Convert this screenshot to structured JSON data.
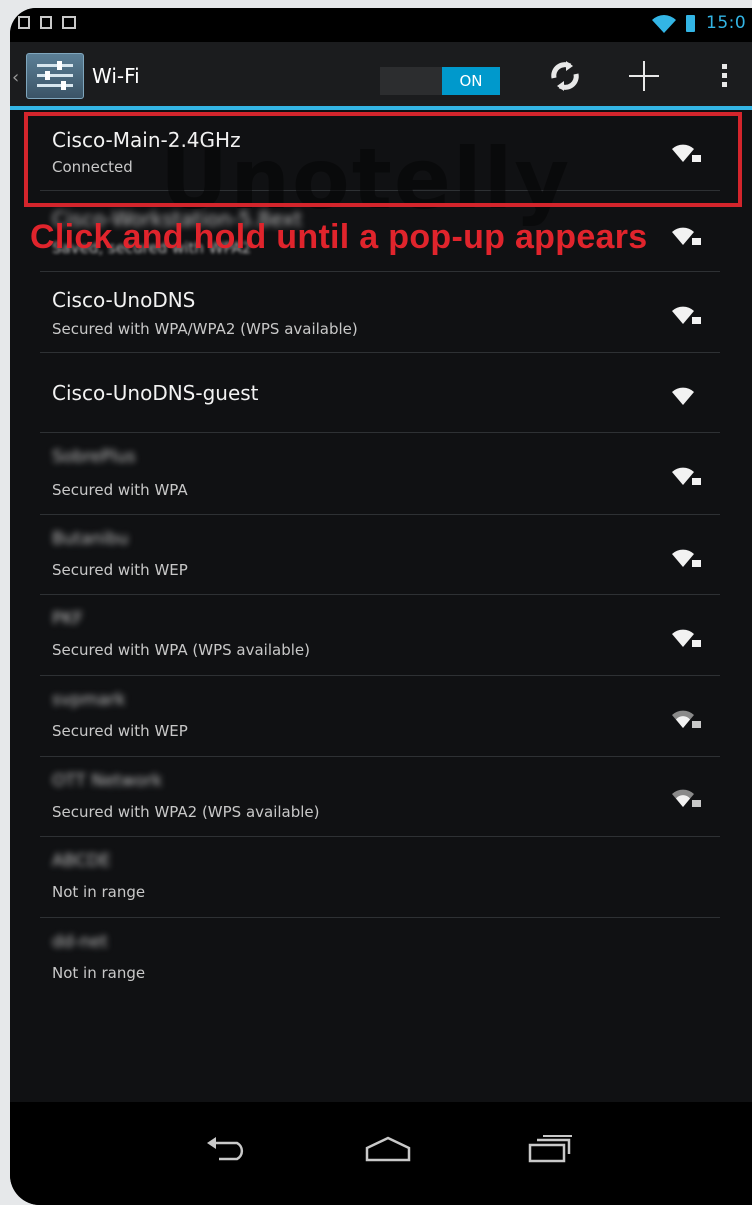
{
  "colors": {
    "accent": "#33b5e5",
    "highlight": "#d4252c",
    "background": "#101113"
  },
  "status_bar": {
    "clock": "15:0",
    "icons": [
      "screenshot-icon",
      "sd-card-icon",
      "media-icon",
      "wifi-signal-icon",
      "battery-icon"
    ]
  },
  "action_bar": {
    "title": "Wi-Fi",
    "toggle_label": "ON",
    "icons": [
      "wps-icon",
      "add-network-icon",
      "overflow-menu-icon"
    ]
  },
  "watermark": "Unotelly",
  "annotation": "Click and hold until a pop-up appears",
  "networks": [
    {
      "name": "Cisco-Main-2.4GHz",
      "status": "Connected",
      "name_blurred": false,
      "signal": "strong",
      "locked": true
    },
    {
      "name": "Cisco-Workstation-5.8ext",
      "status": "Saved, secured with WPA2",
      "name_blurred": false,
      "signal": "strong",
      "locked": true
    },
    {
      "name": "Cisco-UnoDNS",
      "status": "Secured with WPA/WPA2 (WPS available)",
      "name_blurred": false,
      "signal": "strong",
      "locked": true
    },
    {
      "name": "Cisco-UnoDNS-guest",
      "status": "",
      "name_blurred": false,
      "signal": "strong",
      "locked": false
    },
    {
      "name": "SobrePlus",
      "status": "Secured with WPA",
      "name_blurred": true,
      "signal": "strong",
      "locked": true
    },
    {
      "name": "Butanibu",
      "status": "Secured with WEP",
      "name_blurred": true,
      "signal": "strong",
      "locked": true
    },
    {
      "name": "PKF",
      "status": "Secured with WPA (WPS available)",
      "name_blurred": true,
      "signal": "strong",
      "locked": true
    },
    {
      "name": "svpmark",
      "status": "Secured with WEP",
      "name_blurred": true,
      "signal": "weak",
      "locked": true
    },
    {
      "name": "OTT Network",
      "status": "Secured with WPA2 (WPS available)",
      "name_blurred": true,
      "signal": "weak",
      "locked": true
    },
    {
      "name": "ABCDE",
      "status": "Not in range",
      "name_blurred": true,
      "signal": "none",
      "locked": false
    },
    {
      "name": "dd-net",
      "status": "Not in range",
      "name_blurred": true,
      "signal": "none",
      "locked": false
    }
  ],
  "nav_bar": {
    "icons": [
      "back-icon",
      "home-icon",
      "recent-apps-icon"
    ]
  }
}
